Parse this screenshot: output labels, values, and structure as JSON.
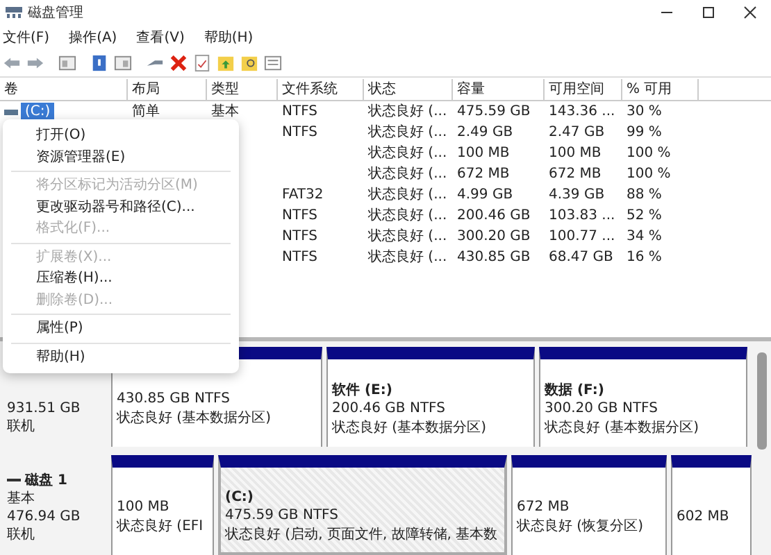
{
  "window": {
    "title": "磁盘管理"
  },
  "menu": [
    "文件(F)",
    "操作(A)",
    "查看(V)",
    "帮助(H)"
  ],
  "table": {
    "columns": [
      "卷",
      "布局",
      "类型",
      "文件系统",
      "状态",
      "容量",
      "可用空间",
      "% 可用"
    ],
    "rows": [
      {
        "volume": "(C:)",
        "layout": "简单",
        "type": "基本",
        "fs": "NTFS",
        "status": "状态良好 (...",
        "capacity": "475.59 GB",
        "free": "143.36 ...",
        "pct": "30 %",
        "selected": true
      },
      {
        "fs": "NTFS",
        "status": "状态良好 (...",
        "capacity": "2.49 GB",
        "free": "2.47 GB",
        "pct": "99 %"
      },
      {
        "status": "状态良好 (...",
        "capacity": "100 MB",
        "free": "100 MB",
        "pct": "100 %"
      },
      {
        "status": "状态良好 (...",
        "capacity": "672 MB",
        "free": "672 MB",
        "pct": "100 %"
      },
      {
        "fs": "FAT32",
        "status": "状态良好 (...",
        "capacity": "4.99 GB",
        "free": "4.39 GB",
        "pct": "88 %"
      },
      {
        "fs": "NTFS",
        "status": "状态良好 (...",
        "capacity": "200.46 GB",
        "free": "103.83 ...",
        "pct": "52 %"
      },
      {
        "fs": "NTFS",
        "status": "状态良好 (...",
        "capacity": "300.20 GB",
        "free": "100.77 ...",
        "pct": "34 %"
      },
      {
        "fs": "NTFS",
        "status": "状态良好 (...",
        "capacity": "430.85 GB",
        "free": "68.47 GB",
        "pct": "16 %"
      }
    ]
  },
  "context_menu": [
    {
      "kind": "item",
      "label": "打开(O)",
      "disabled": false
    },
    {
      "kind": "item",
      "label": "资源管理器(E)",
      "disabled": false
    },
    {
      "kind": "separator"
    },
    {
      "kind": "item",
      "label": "将分区标记为活动分区(M)",
      "disabled": true
    },
    {
      "kind": "item",
      "label": "更改驱动器号和路径(C)...",
      "disabled": false
    },
    {
      "kind": "item",
      "label": "格式化(F)...",
      "disabled": true
    },
    {
      "kind": "separator"
    },
    {
      "kind": "item",
      "label": "扩展卷(X)...",
      "disabled": true
    },
    {
      "kind": "item",
      "label": "压缩卷(H)...",
      "disabled": false
    },
    {
      "kind": "item",
      "label": "删除卷(D)...",
      "disabled": true
    },
    {
      "kind": "separator"
    },
    {
      "kind": "item",
      "label": "属性(P)",
      "disabled": false
    },
    {
      "kind": "separator"
    },
    {
      "kind": "item",
      "label": "帮助(H)",
      "disabled": false
    }
  ],
  "disks": [
    {
      "info": [
        "931.51 GB",
        "联机"
      ],
      "partitions": [
        {
          "size": "430.85 GB NTFS",
          "status": "状态良好 (基本数据分区)",
          "selected": false
        },
        {
          "title": "软件  (E:)",
          "size": "200.46 GB NTFS",
          "status": "状态良好 (基本数据分区)",
          "selected": false
        },
        {
          "title": "数据  (F:)",
          "size": "300.20 GB NTFS",
          "status": "状态良好 (基本数据分区)",
          "selected": false
        }
      ]
    },
    {
      "name": "磁盘 1",
      "info": [
        "基本",
        "476.94 GB",
        "联机"
      ],
      "partitions": [
        {
          "size": "100 MB",
          "status": "状态良好 (EFI",
          "selected": false
        },
        {
          "title": "(C:)",
          "size": "475.59 GB NTFS",
          "status": "状态良好 (启动, 页面文件, 故障转储, 基本数",
          "selected": true
        },
        {
          "size": "672 MB",
          "status": "状态良好 (恢复分区)",
          "selected": false
        },
        {
          "size": "602 MB",
          "selected": false
        }
      ]
    }
  ]
}
